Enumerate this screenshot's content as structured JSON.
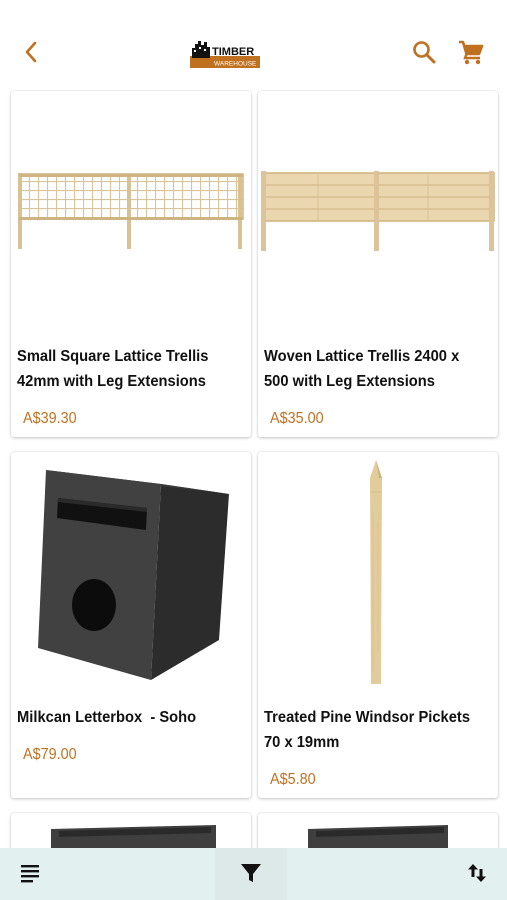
{
  "header": {
    "back_icon": "chevron-left-icon",
    "logo_text_line1": "TIMBER",
    "logo_text_line2": "WAREHOUSE",
    "search_icon": "search-icon",
    "cart_icon": "cart-icon"
  },
  "colors": {
    "accent": "#c0711f",
    "bottom_bar": "#e3f0f0"
  },
  "products": [
    {
      "name_line1": "Small Square Lattice Trellis",
      "name_line2": "42mm with Leg Extensions",
      "price": "A$39.30"
    },
    {
      "name_line1": "Woven Lattice Trellis 2400 x",
      "name_line2": "500 with Leg Extensions",
      "price": "A$35.00"
    },
    {
      "name_line1": "Milkcan Letterbox  - Soho",
      "name_line2": "",
      "price": "A$79.00"
    },
    {
      "name_line1": "Treated Pine Windsor Pickets",
      "name_line2": "70 x 19mm",
      "price": "A$5.80"
    }
  ],
  "bottom_bar": {
    "list_icon": "list-icon",
    "filter_icon": "filter-icon",
    "sort_icon": "sort-icon"
  }
}
